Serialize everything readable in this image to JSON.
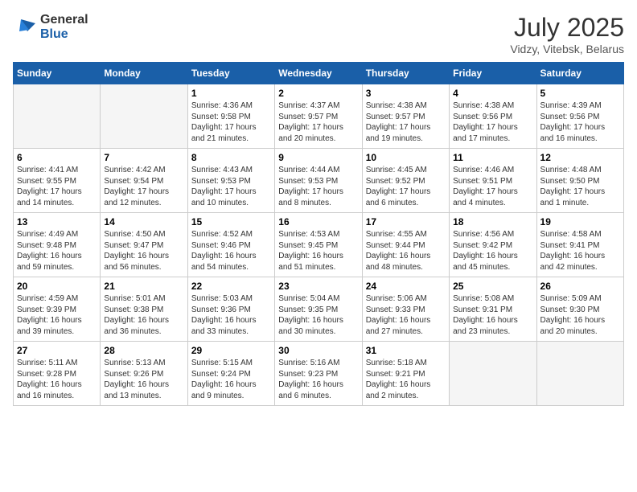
{
  "logo": {
    "general": "General",
    "blue": "Blue"
  },
  "title": {
    "month_year": "July 2025",
    "location": "Vidzy, Vitebsk, Belarus"
  },
  "days_of_week": [
    "Sunday",
    "Monday",
    "Tuesday",
    "Wednesday",
    "Thursday",
    "Friday",
    "Saturday"
  ],
  "weeks": [
    [
      {
        "day": "",
        "empty": true
      },
      {
        "day": "",
        "empty": true
      },
      {
        "day": "1",
        "sunrise": "4:36 AM",
        "sunset": "9:58 PM",
        "daylight": "17 hours and 21 minutes."
      },
      {
        "day": "2",
        "sunrise": "4:37 AM",
        "sunset": "9:57 PM",
        "daylight": "17 hours and 20 minutes."
      },
      {
        "day": "3",
        "sunrise": "4:38 AM",
        "sunset": "9:57 PM",
        "daylight": "17 hours and 19 minutes."
      },
      {
        "day": "4",
        "sunrise": "4:38 AM",
        "sunset": "9:56 PM",
        "daylight": "17 hours and 17 minutes."
      },
      {
        "day": "5",
        "sunrise": "4:39 AM",
        "sunset": "9:56 PM",
        "daylight": "17 hours and 16 minutes."
      }
    ],
    [
      {
        "day": "6",
        "sunrise": "4:41 AM",
        "sunset": "9:55 PM",
        "daylight": "17 hours and 14 minutes."
      },
      {
        "day": "7",
        "sunrise": "4:42 AM",
        "sunset": "9:54 PM",
        "daylight": "17 hours and 12 minutes."
      },
      {
        "day": "8",
        "sunrise": "4:43 AM",
        "sunset": "9:53 PM",
        "daylight": "17 hours and 10 minutes."
      },
      {
        "day": "9",
        "sunrise": "4:44 AM",
        "sunset": "9:53 PM",
        "daylight": "17 hours and 8 minutes."
      },
      {
        "day": "10",
        "sunrise": "4:45 AM",
        "sunset": "9:52 PM",
        "daylight": "17 hours and 6 minutes."
      },
      {
        "day": "11",
        "sunrise": "4:46 AM",
        "sunset": "9:51 PM",
        "daylight": "17 hours and 4 minutes."
      },
      {
        "day": "12",
        "sunrise": "4:48 AM",
        "sunset": "9:50 PM",
        "daylight": "17 hours and 1 minute."
      }
    ],
    [
      {
        "day": "13",
        "sunrise": "4:49 AM",
        "sunset": "9:48 PM",
        "daylight": "16 hours and 59 minutes."
      },
      {
        "day": "14",
        "sunrise": "4:50 AM",
        "sunset": "9:47 PM",
        "daylight": "16 hours and 56 minutes."
      },
      {
        "day": "15",
        "sunrise": "4:52 AM",
        "sunset": "9:46 PM",
        "daylight": "16 hours and 54 minutes."
      },
      {
        "day": "16",
        "sunrise": "4:53 AM",
        "sunset": "9:45 PM",
        "daylight": "16 hours and 51 minutes."
      },
      {
        "day": "17",
        "sunrise": "4:55 AM",
        "sunset": "9:44 PM",
        "daylight": "16 hours and 48 minutes."
      },
      {
        "day": "18",
        "sunrise": "4:56 AM",
        "sunset": "9:42 PM",
        "daylight": "16 hours and 45 minutes."
      },
      {
        "day": "19",
        "sunrise": "4:58 AM",
        "sunset": "9:41 PM",
        "daylight": "16 hours and 42 minutes."
      }
    ],
    [
      {
        "day": "20",
        "sunrise": "4:59 AM",
        "sunset": "9:39 PM",
        "daylight": "16 hours and 39 minutes."
      },
      {
        "day": "21",
        "sunrise": "5:01 AM",
        "sunset": "9:38 PM",
        "daylight": "16 hours and 36 minutes."
      },
      {
        "day": "22",
        "sunrise": "5:03 AM",
        "sunset": "9:36 PM",
        "daylight": "16 hours and 33 minutes."
      },
      {
        "day": "23",
        "sunrise": "5:04 AM",
        "sunset": "9:35 PM",
        "daylight": "16 hours and 30 minutes."
      },
      {
        "day": "24",
        "sunrise": "5:06 AM",
        "sunset": "9:33 PM",
        "daylight": "16 hours and 27 minutes."
      },
      {
        "day": "25",
        "sunrise": "5:08 AM",
        "sunset": "9:31 PM",
        "daylight": "16 hours and 23 minutes."
      },
      {
        "day": "26",
        "sunrise": "5:09 AM",
        "sunset": "9:30 PM",
        "daylight": "16 hours and 20 minutes."
      }
    ],
    [
      {
        "day": "27",
        "sunrise": "5:11 AM",
        "sunset": "9:28 PM",
        "daylight": "16 hours and 16 minutes."
      },
      {
        "day": "28",
        "sunrise": "5:13 AM",
        "sunset": "9:26 PM",
        "daylight": "16 hours and 13 minutes."
      },
      {
        "day": "29",
        "sunrise": "5:15 AM",
        "sunset": "9:24 PM",
        "daylight": "16 hours and 9 minutes."
      },
      {
        "day": "30",
        "sunrise": "5:16 AM",
        "sunset": "9:23 PM",
        "daylight": "16 hours and 6 minutes."
      },
      {
        "day": "31",
        "sunrise": "5:18 AM",
        "sunset": "9:21 PM",
        "daylight": "16 hours and 2 minutes."
      },
      {
        "day": "",
        "empty": true
      },
      {
        "day": "",
        "empty": true
      }
    ]
  ],
  "labels": {
    "sunrise": "Sunrise:",
    "sunset": "Sunset:",
    "daylight": "Daylight:"
  }
}
